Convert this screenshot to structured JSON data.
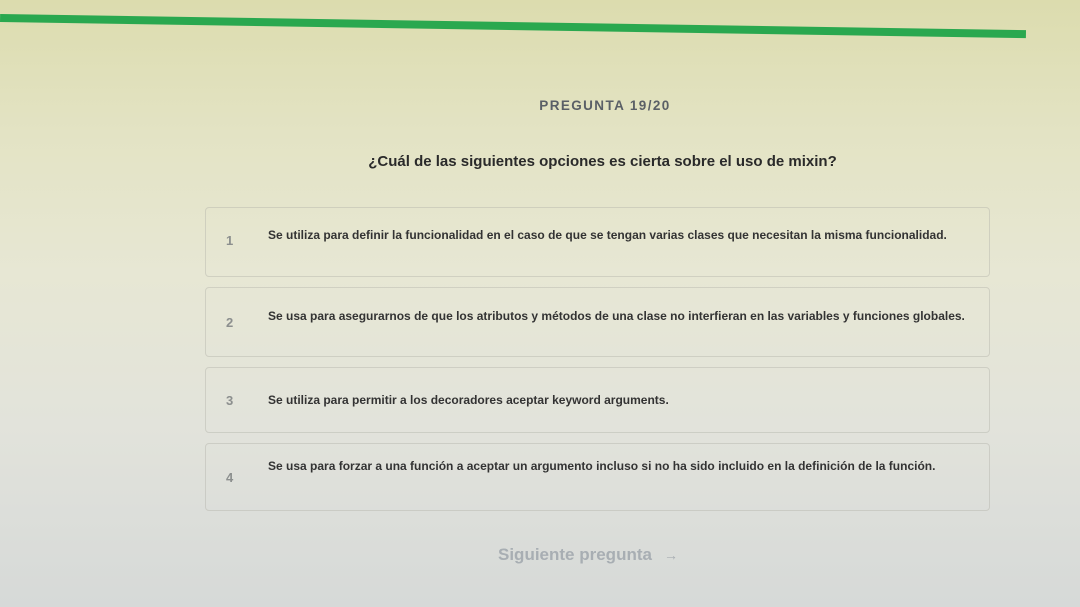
{
  "progress": {
    "value": 0.95
  },
  "header": {
    "counter": "PREGUNTA 19/20"
  },
  "question": {
    "text": "¿Cuál de las siguientes opciones es cierta sobre el uso de mixin?"
  },
  "options": [
    {
      "number": "1",
      "text": "Se utiliza para definir la funcionalidad en el caso de que se tengan varias clases que necesitan la misma funcionalidad."
    },
    {
      "number": "2",
      "text": "Se usa para asegurarnos de que los atributos y métodos de una clase no interfieran en las variables y funciones globales."
    },
    {
      "number": "3",
      "text": "Se utiliza para permitir a los decoradores aceptar keyword arguments."
    },
    {
      "number": "4",
      "text": "Se usa para forzar a una función a aceptar un argumento incluso si no ha sido incluido en la definición de la función."
    }
  ],
  "footer": {
    "next_label": "Siguiente pregunta",
    "next_icon": "arrow-right-icon"
  },
  "colors": {
    "progress": "#2aa84f",
    "next_disabled": "#a8aeb3"
  }
}
